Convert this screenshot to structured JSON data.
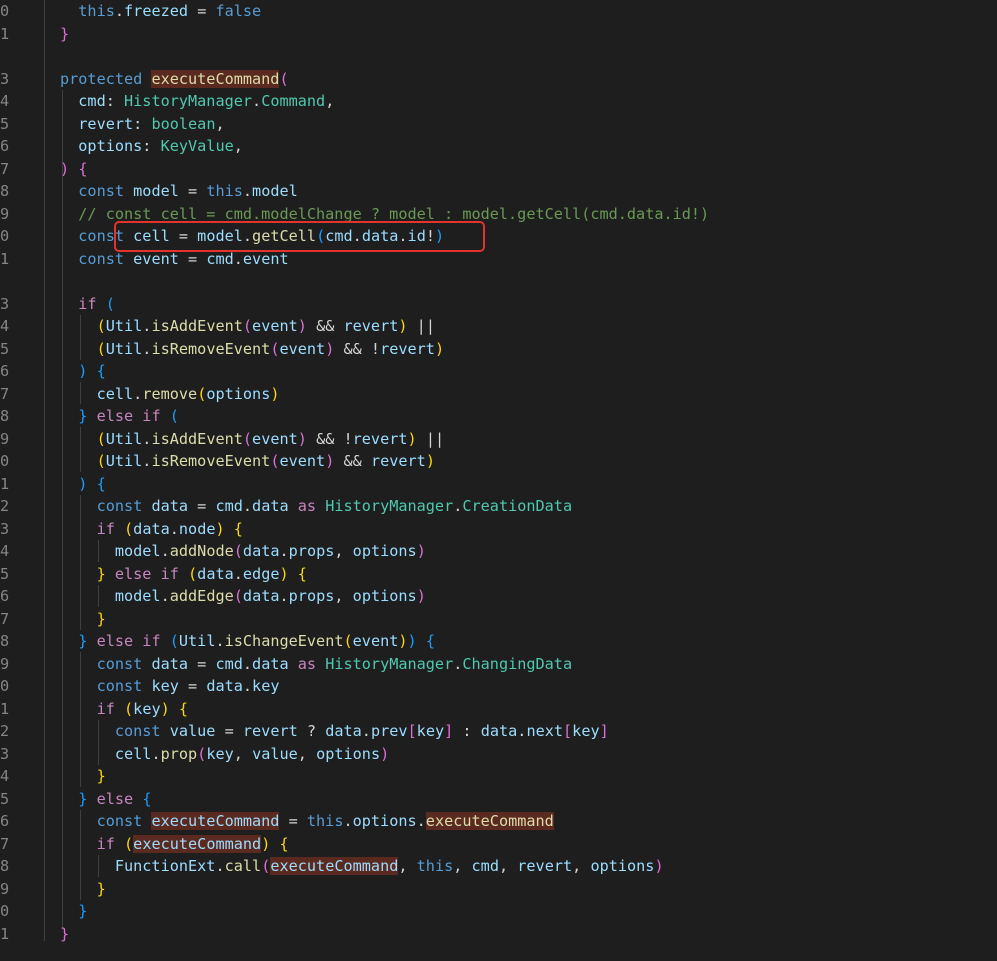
{
  "editor": {
    "line_numbers": [
      "0",
      "1",
      "",
      "3",
      "4",
      "5",
      "6",
      "7",
      "8",
      "9",
      "0",
      "1",
      "",
      "3",
      "4",
      "5",
      "6",
      "7",
      "8",
      "9",
      "0",
      "1",
      "2",
      "3",
      "4",
      "5",
      "6",
      "7",
      "8",
      "9",
      "0",
      "1",
      "2",
      "3",
      "4",
      "5",
      "6",
      "7",
      "8",
      "9",
      "0",
      "1"
    ],
    "lines": [
      [
        {
          "t": "  this",
          "c": "k"
        },
        {
          "t": ".",
          "c": "p"
        },
        {
          "t": "freezed",
          "c": "v"
        },
        {
          "t": " = ",
          "c": "p"
        },
        {
          "t": "false",
          "c": "k"
        }
      ],
      [
        {
          "t": "}",
          "c": "b2"
        }
      ],
      [],
      [
        {
          "t": "protected ",
          "c": "k"
        },
        {
          "t": "executeCommand",
          "c": "hl"
        },
        {
          "t": "(",
          "c": "b2"
        }
      ],
      [
        {
          "t": "  cmd",
          "c": "v"
        },
        {
          "t": ": ",
          "c": "p"
        },
        {
          "t": "HistoryManager",
          "c": "t"
        },
        {
          "t": ".",
          "c": "p"
        },
        {
          "t": "Command",
          "c": "t"
        },
        {
          "t": ",",
          "c": "p"
        }
      ],
      [
        {
          "t": "  revert",
          "c": "v"
        },
        {
          "t": ": ",
          "c": "p"
        },
        {
          "t": "boolean",
          "c": "t"
        },
        {
          "t": ",",
          "c": "p"
        }
      ],
      [
        {
          "t": "  options",
          "c": "v"
        },
        {
          "t": ": ",
          "c": "p"
        },
        {
          "t": "KeyValue",
          "c": "t"
        },
        {
          "t": ",",
          "c": "p"
        }
      ],
      [
        {
          "t": ")",
          "c": "b2"
        },
        {
          "t": " ",
          "c": "p"
        },
        {
          "t": "{",
          "c": "b2"
        }
      ],
      [
        {
          "t": "  const ",
          "c": "k"
        },
        {
          "t": "model",
          "c": "v"
        },
        {
          "t": " = ",
          "c": "p"
        },
        {
          "t": "this",
          "c": "k"
        },
        {
          "t": ".",
          "c": "p"
        },
        {
          "t": "model",
          "c": "v"
        }
      ],
      [
        {
          "t": "  // const cell = cmd.modelChange ? model : model.getCell(cmd.data.id!)",
          "c": "c"
        }
      ],
      [
        {
          "t": "  const ",
          "c": "k"
        },
        {
          "t": "cell",
          "c": "v"
        },
        {
          "t": " = ",
          "c": "p"
        },
        {
          "t": "model",
          "c": "v"
        },
        {
          "t": ".",
          "c": "p"
        },
        {
          "t": "getCell",
          "c": "f"
        },
        {
          "t": "(",
          "c": "b3"
        },
        {
          "t": "cmd",
          "c": "v"
        },
        {
          "t": ".",
          "c": "p"
        },
        {
          "t": "data",
          "c": "v"
        },
        {
          "t": ".",
          "c": "p"
        },
        {
          "t": "id",
          "c": "v"
        },
        {
          "t": "!",
          "c": "p"
        },
        {
          "t": ")",
          "c": "b3"
        }
      ],
      [
        {
          "t": "  const ",
          "c": "k"
        },
        {
          "t": "event",
          "c": "v"
        },
        {
          "t": " = ",
          "c": "p"
        },
        {
          "t": "cmd",
          "c": "v"
        },
        {
          "t": ".",
          "c": "p"
        },
        {
          "t": "event",
          "c": "v"
        }
      ],
      [],
      [
        {
          "t": "  if ",
          "c": "ctl"
        },
        {
          "t": "(",
          "c": "b3"
        }
      ],
      [
        {
          "t": "    (",
          "c": "b1"
        },
        {
          "t": "Util",
          "c": "v"
        },
        {
          "t": ".",
          "c": "p"
        },
        {
          "t": "isAddEvent",
          "c": "f"
        },
        {
          "t": "(",
          "c": "b2"
        },
        {
          "t": "event",
          "c": "v"
        },
        {
          "t": ")",
          "c": "b2"
        },
        {
          "t": " && ",
          "c": "p"
        },
        {
          "t": "revert",
          "c": "v"
        },
        {
          "t": ")",
          "c": "b1"
        },
        {
          "t": " ||",
          "c": "p"
        }
      ],
      [
        {
          "t": "    (",
          "c": "b1"
        },
        {
          "t": "Util",
          "c": "v"
        },
        {
          "t": ".",
          "c": "p"
        },
        {
          "t": "isRemoveEvent",
          "c": "f"
        },
        {
          "t": "(",
          "c": "b2"
        },
        {
          "t": "event",
          "c": "v"
        },
        {
          "t": ")",
          "c": "b2"
        },
        {
          "t": " && !",
          "c": "p"
        },
        {
          "t": "revert",
          "c": "v"
        },
        {
          "t": ")",
          "c": "b1"
        }
      ],
      [
        {
          "t": "  )",
          "c": "b3"
        },
        {
          "t": " ",
          "c": "p"
        },
        {
          "t": "{",
          "c": "b3"
        }
      ],
      [
        {
          "t": "    cell",
          "c": "v"
        },
        {
          "t": ".",
          "c": "p"
        },
        {
          "t": "remove",
          "c": "f"
        },
        {
          "t": "(",
          "c": "b1"
        },
        {
          "t": "options",
          "c": "v"
        },
        {
          "t": ")",
          "c": "b1"
        }
      ],
      [
        {
          "t": "  }",
          "c": "b3"
        },
        {
          "t": " else if ",
          "c": "ctl"
        },
        {
          "t": "(",
          "c": "b3"
        }
      ],
      [
        {
          "t": "    (",
          "c": "b1"
        },
        {
          "t": "Util",
          "c": "v"
        },
        {
          "t": ".",
          "c": "p"
        },
        {
          "t": "isAddEvent",
          "c": "f"
        },
        {
          "t": "(",
          "c": "b2"
        },
        {
          "t": "event",
          "c": "v"
        },
        {
          "t": ")",
          "c": "b2"
        },
        {
          "t": " && !",
          "c": "p"
        },
        {
          "t": "revert",
          "c": "v"
        },
        {
          "t": ")",
          "c": "b1"
        },
        {
          "t": " ||",
          "c": "p"
        }
      ],
      [
        {
          "t": "    (",
          "c": "b1"
        },
        {
          "t": "Util",
          "c": "v"
        },
        {
          "t": ".",
          "c": "p"
        },
        {
          "t": "isRemoveEvent",
          "c": "f"
        },
        {
          "t": "(",
          "c": "b2"
        },
        {
          "t": "event",
          "c": "v"
        },
        {
          "t": ")",
          "c": "b2"
        },
        {
          "t": " && ",
          "c": "p"
        },
        {
          "t": "revert",
          "c": "v"
        },
        {
          "t": ")",
          "c": "b1"
        }
      ],
      [
        {
          "t": "  )",
          "c": "b3"
        },
        {
          "t": " ",
          "c": "p"
        },
        {
          "t": "{",
          "c": "b3"
        }
      ],
      [
        {
          "t": "    const ",
          "c": "k"
        },
        {
          "t": "data",
          "c": "v"
        },
        {
          "t": " = ",
          "c": "p"
        },
        {
          "t": "cmd",
          "c": "v"
        },
        {
          "t": ".",
          "c": "p"
        },
        {
          "t": "data",
          "c": "v"
        },
        {
          "t": " as ",
          "c": "ctl"
        },
        {
          "t": "HistoryManager",
          "c": "t"
        },
        {
          "t": ".",
          "c": "p"
        },
        {
          "t": "CreationData",
          "c": "t"
        }
      ],
      [
        {
          "t": "    if ",
          "c": "ctl"
        },
        {
          "t": "(",
          "c": "b1"
        },
        {
          "t": "data",
          "c": "v"
        },
        {
          "t": ".",
          "c": "p"
        },
        {
          "t": "node",
          "c": "v"
        },
        {
          "t": ")",
          "c": "b1"
        },
        {
          "t": " ",
          "c": "p"
        },
        {
          "t": "{",
          "c": "b1"
        }
      ],
      [
        {
          "t": "      model",
          "c": "v"
        },
        {
          "t": ".",
          "c": "p"
        },
        {
          "t": "addNode",
          "c": "f"
        },
        {
          "t": "(",
          "c": "b2"
        },
        {
          "t": "data",
          "c": "v"
        },
        {
          "t": ".",
          "c": "p"
        },
        {
          "t": "props",
          "c": "v"
        },
        {
          "t": ", ",
          "c": "p"
        },
        {
          "t": "options",
          "c": "v"
        },
        {
          "t": ")",
          "c": "b2"
        }
      ],
      [
        {
          "t": "    }",
          "c": "b1"
        },
        {
          "t": " else if ",
          "c": "ctl"
        },
        {
          "t": "(",
          "c": "b1"
        },
        {
          "t": "data",
          "c": "v"
        },
        {
          "t": ".",
          "c": "p"
        },
        {
          "t": "edge",
          "c": "v"
        },
        {
          "t": ")",
          "c": "b1"
        },
        {
          "t": " ",
          "c": "p"
        },
        {
          "t": "{",
          "c": "b1"
        }
      ],
      [
        {
          "t": "      model",
          "c": "v"
        },
        {
          "t": ".",
          "c": "p"
        },
        {
          "t": "addEdge",
          "c": "f"
        },
        {
          "t": "(",
          "c": "b2"
        },
        {
          "t": "data",
          "c": "v"
        },
        {
          "t": ".",
          "c": "p"
        },
        {
          "t": "props",
          "c": "v"
        },
        {
          "t": ", ",
          "c": "p"
        },
        {
          "t": "options",
          "c": "v"
        },
        {
          "t": ")",
          "c": "b2"
        }
      ],
      [
        {
          "t": "    }",
          "c": "b1"
        }
      ],
      [
        {
          "t": "  }",
          "c": "b3"
        },
        {
          "t": " else if ",
          "c": "ctl"
        },
        {
          "t": "(",
          "c": "b3"
        },
        {
          "t": "Util",
          "c": "v"
        },
        {
          "t": ".",
          "c": "p"
        },
        {
          "t": "isChangeEvent",
          "c": "f"
        },
        {
          "t": "(",
          "c": "b1"
        },
        {
          "t": "event",
          "c": "v"
        },
        {
          "t": ")",
          "c": "b1"
        },
        {
          "t": ")",
          "c": "b3"
        },
        {
          "t": " ",
          "c": "p"
        },
        {
          "t": "{",
          "c": "b3"
        }
      ],
      [
        {
          "t": "    const ",
          "c": "k"
        },
        {
          "t": "data",
          "c": "v"
        },
        {
          "t": " = ",
          "c": "p"
        },
        {
          "t": "cmd",
          "c": "v"
        },
        {
          "t": ".",
          "c": "p"
        },
        {
          "t": "data",
          "c": "v"
        },
        {
          "t": " as ",
          "c": "ctl"
        },
        {
          "t": "HistoryManager",
          "c": "t"
        },
        {
          "t": ".",
          "c": "p"
        },
        {
          "t": "ChangingData",
          "c": "t"
        }
      ],
      [
        {
          "t": "    const ",
          "c": "k"
        },
        {
          "t": "key",
          "c": "v"
        },
        {
          "t": " = ",
          "c": "p"
        },
        {
          "t": "data",
          "c": "v"
        },
        {
          "t": ".",
          "c": "p"
        },
        {
          "t": "key",
          "c": "v"
        }
      ],
      [
        {
          "t": "    if ",
          "c": "ctl"
        },
        {
          "t": "(",
          "c": "b1"
        },
        {
          "t": "key",
          "c": "v"
        },
        {
          "t": ")",
          "c": "b1"
        },
        {
          "t": " ",
          "c": "p"
        },
        {
          "t": "{",
          "c": "b1"
        }
      ],
      [
        {
          "t": "      const ",
          "c": "k"
        },
        {
          "t": "value",
          "c": "v"
        },
        {
          "t": " = ",
          "c": "p"
        },
        {
          "t": "revert",
          "c": "v"
        },
        {
          "t": " ? ",
          "c": "p"
        },
        {
          "t": "data",
          "c": "v"
        },
        {
          "t": ".",
          "c": "p"
        },
        {
          "t": "prev",
          "c": "v"
        },
        {
          "t": "[",
          "c": "b2"
        },
        {
          "t": "key",
          "c": "v"
        },
        {
          "t": "]",
          "c": "b2"
        },
        {
          "t": " : ",
          "c": "p"
        },
        {
          "t": "data",
          "c": "v"
        },
        {
          "t": ".",
          "c": "p"
        },
        {
          "t": "next",
          "c": "v"
        },
        {
          "t": "[",
          "c": "b2"
        },
        {
          "t": "key",
          "c": "v"
        },
        {
          "t": "]",
          "c": "b2"
        }
      ],
      [
        {
          "t": "      cell",
          "c": "v"
        },
        {
          "t": ".",
          "c": "p"
        },
        {
          "t": "prop",
          "c": "f"
        },
        {
          "t": "(",
          "c": "b2"
        },
        {
          "t": "key",
          "c": "v"
        },
        {
          "t": ", ",
          "c": "p"
        },
        {
          "t": "value",
          "c": "v"
        },
        {
          "t": ", ",
          "c": "p"
        },
        {
          "t": "options",
          "c": "v"
        },
        {
          "t": ")",
          "c": "b2"
        }
      ],
      [
        {
          "t": "    }",
          "c": "b1"
        }
      ],
      [
        {
          "t": "  }",
          "c": "b3"
        },
        {
          "t": " else ",
          "c": "ctl"
        },
        {
          "t": "{",
          "c": "b3"
        }
      ],
      [
        {
          "t": "    const ",
          "c": "k"
        },
        {
          "t": "executeCommand",
          "c": "hlv"
        },
        {
          "t": " = ",
          "c": "p"
        },
        {
          "t": "this",
          "c": "k"
        },
        {
          "t": ".",
          "c": "p"
        },
        {
          "t": "options",
          "c": "v"
        },
        {
          "t": ".",
          "c": "p"
        },
        {
          "t": "executeCommand",
          "c": "hl"
        }
      ],
      [
        {
          "t": "    if ",
          "c": "ctl"
        },
        {
          "t": "(",
          "c": "b1"
        },
        {
          "t": "executeCommand",
          "c": "hlv"
        },
        {
          "t": ")",
          "c": "b1"
        },
        {
          "t": " ",
          "c": "p"
        },
        {
          "t": "{",
          "c": "b1"
        }
      ],
      [
        {
          "t": "      FunctionExt",
          "c": "v"
        },
        {
          "t": ".",
          "c": "p"
        },
        {
          "t": "call",
          "c": "f"
        },
        {
          "t": "(",
          "c": "b2"
        },
        {
          "t": "executeCommand",
          "c": "hlv"
        },
        {
          "t": ", ",
          "c": "p"
        },
        {
          "t": "this",
          "c": "k"
        },
        {
          "t": ", ",
          "c": "p"
        },
        {
          "t": "cmd",
          "c": "v"
        },
        {
          "t": ", ",
          "c": "p"
        },
        {
          "t": "revert",
          "c": "v"
        },
        {
          "t": ", ",
          "c": "p"
        },
        {
          "t": "options",
          "c": "v"
        },
        {
          "t": ")",
          "c": "b2"
        }
      ],
      [
        {
          "t": "    }",
          "c": "b1"
        }
      ],
      [
        {
          "t": "  }",
          "c": "b3"
        }
      ],
      [
        {
          "t": "}",
          "c": "b2"
        }
      ]
    ]
  }
}
